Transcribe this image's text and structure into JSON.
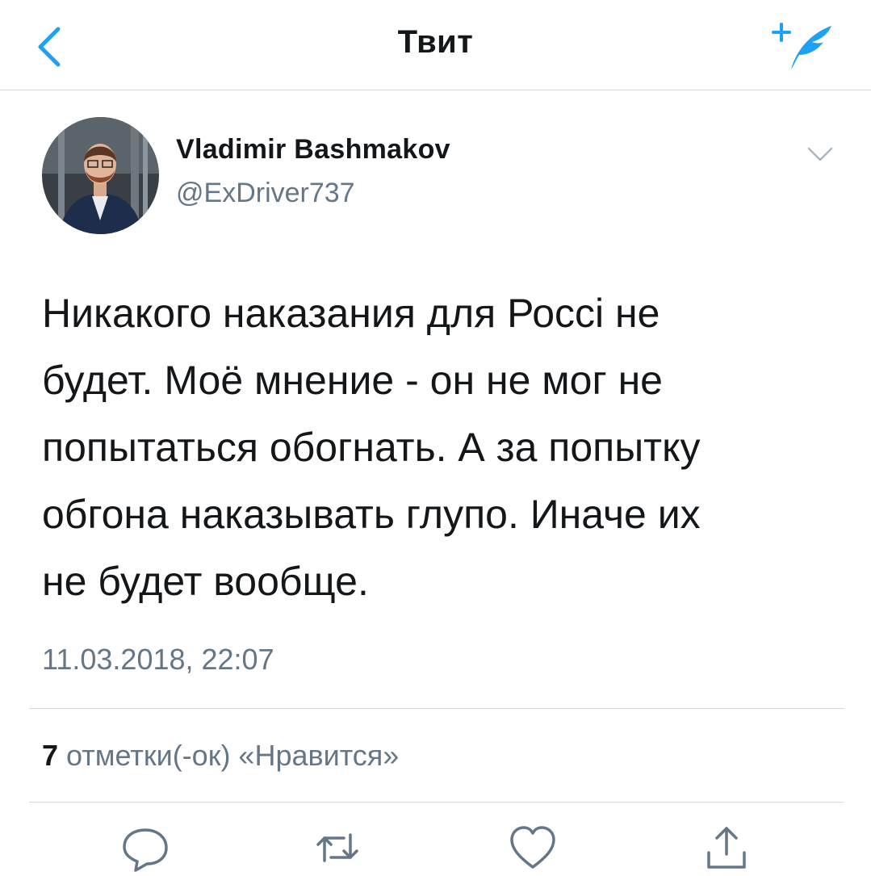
{
  "nav": {
    "title": "Твит",
    "back_icon": "chevron-left-icon",
    "compose_icon": "compose-tweet-icon",
    "accent_color": "#1da1f2"
  },
  "tweet": {
    "author_name": "Vladimir Bashmakov",
    "author_handle": "@ExDriver737",
    "text": "Никакого наказания для Россi не\nбудет. Моё мнение - он не мог не\nпопытаться обогнать. А за попытку\nобгона наказывать глупо. Иначе их\nне будет вообще.",
    "timestamp": "11.03.2018, 22:07",
    "likes_count": "7",
    "likes_label": "отметки(-ок) «Нравится»"
  },
  "actions": [
    "reply-icon",
    "retweet-icon",
    "like-icon",
    "share-icon"
  ]
}
